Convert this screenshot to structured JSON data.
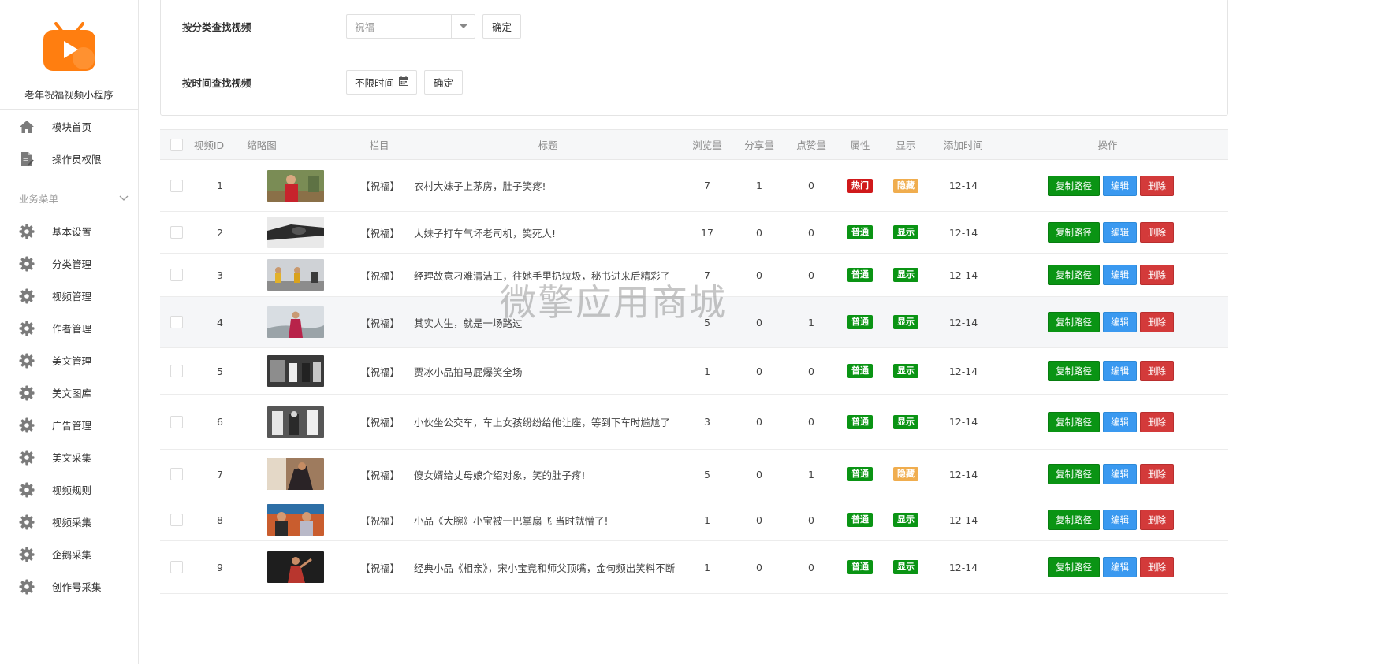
{
  "app": {
    "name": "老年祝福视频小程序",
    "brand_color": "#ff7e10"
  },
  "sidebar": {
    "top_items": [
      {
        "label": "模块首页",
        "icon": "home-icon"
      },
      {
        "label": "操作员权限",
        "icon": "file-edit-icon"
      }
    ],
    "group": {
      "label": "业务菜单",
      "icon": "chevron-down-icon"
    },
    "items": [
      {
        "label": "基本设置",
        "icon": "gear-icon"
      },
      {
        "label": "分类管理",
        "icon": "gear-icon"
      },
      {
        "label": "视频管理",
        "icon": "gear-icon"
      },
      {
        "label": "作者管理",
        "icon": "gear-icon"
      },
      {
        "label": "美文管理",
        "icon": "gear-icon"
      },
      {
        "label": "美文图库",
        "icon": "gear-icon"
      },
      {
        "label": "广告管理",
        "icon": "gear-icon"
      },
      {
        "label": "美文采集",
        "icon": "gear-icon"
      },
      {
        "label": "视频规则",
        "icon": "gear-icon"
      },
      {
        "label": "视频采集",
        "icon": "gear-icon"
      },
      {
        "label": "企鹅采集",
        "icon": "gear-icon"
      },
      {
        "label": "创作号采集",
        "icon": "gear-icon"
      }
    ]
  },
  "filters": {
    "category": {
      "label": "按分类查找视频",
      "selected": "祝福",
      "confirm": "确定"
    },
    "time": {
      "label": "按时间查找视频",
      "value": "不限时间",
      "icon": "calendar-icon",
      "confirm": "确定"
    }
  },
  "table": {
    "headers": {
      "id": "视频ID",
      "thumb": "缩略图",
      "column": "栏目",
      "title": "标题",
      "views": "浏览量",
      "shares": "分享量",
      "likes": "点赞量",
      "attr": "属性",
      "display": "显示",
      "added": "添加时间",
      "actions": "操作"
    },
    "actions": {
      "copy": "复制路径",
      "edit": "编辑",
      "delete": "删除"
    },
    "status_colors": {
      "hot": "#d0191b",
      "normal": "#0a9414",
      "show": "#0a9414",
      "hidden": "#f0ad4e"
    },
    "rows": [
      {
        "id": "1",
        "column": "【祝福】",
        "title": "农村大妹子上茅房，肚子笑疼!",
        "views": "7",
        "shares": "1",
        "likes": "0",
        "attr": "热门",
        "attr_type": "hot",
        "display": "隐藏",
        "display_type": "hidden",
        "added": "12-14",
        "thumb": "thumb-woman-red-dress"
      },
      {
        "id": "2",
        "column": "【祝福】",
        "title": "大妹子打车气坏老司机，笑死人!",
        "views": "17",
        "shares": "0",
        "likes": "0",
        "attr": "普通",
        "attr_type": "normal",
        "display": "显示",
        "display_type": "show",
        "added": "12-14",
        "thumb": "thumb-car-interior"
      },
      {
        "id": "3",
        "column": "【祝福】",
        "title": "经理故意刁难清洁工，往她手里扔垃圾，秘书进来后精彩了",
        "views": "7",
        "shares": "0",
        "likes": "0",
        "attr": "普通",
        "attr_type": "normal",
        "display": "显示",
        "display_type": "show",
        "added": "12-14",
        "thumb": "thumb-stage-performers"
      },
      {
        "id": "4",
        "column": "【祝福】",
        "title": "其实人生，就是一场路过",
        "views": "5",
        "shares": "0",
        "likes": "1",
        "attr": "普通",
        "attr_type": "normal",
        "display": "显示",
        "display_type": "show",
        "added": "12-14",
        "thumb": "thumb-singer-outdoor"
      },
      {
        "id": "5",
        "column": "【祝福】",
        "title": "贾冰小品拍马屁爆笑全场",
        "views": "1",
        "shares": "0",
        "likes": "0",
        "attr": "普通",
        "attr_type": "normal",
        "display": "显示",
        "display_type": "show",
        "added": "12-14",
        "thumb": "thumb-comedy-stage"
      },
      {
        "id": "6",
        "column": "【祝福】",
        "title": "小伙坐公交车，车上女孩纷纷给他让座，等到下车时尴尬了",
        "views": "3",
        "shares": "0",
        "likes": "0",
        "attr": "普通",
        "attr_type": "normal",
        "display": "显示",
        "display_type": "show",
        "added": "12-14",
        "thumb": "thumb-bus-passengers"
      },
      {
        "id": "7",
        "column": "【祝福】",
        "title": "傻女婿给丈母娘介绍对象，笑的肚子疼!",
        "views": "5",
        "shares": "0",
        "likes": "1",
        "attr": "普通",
        "attr_type": "normal",
        "display": "隐藏",
        "display_type": "hidden",
        "added": "12-14",
        "thumb": "thumb-family-scene"
      },
      {
        "id": "8",
        "column": "【祝福】",
        "title": "小品《大腕》小宝被一巴掌扇飞 当时就懵了!",
        "views": "1",
        "shares": "0",
        "likes": "0",
        "attr": "普通",
        "attr_type": "normal",
        "display": "显示",
        "display_type": "show",
        "added": "12-14",
        "thumb": "thumb-sketch-actors"
      },
      {
        "id": "9",
        "column": "【祝福】",
        "title": "经典小品《相亲》，宋小宝竟和师父顶嘴，金句频出笑料不断",
        "views": "1",
        "shares": "0",
        "likes": "0",
        "attr": "普通",
        "attr_type": "normal",
        "display": "显示",
        "display_type": "show",
        "added": "12-14",
        "thumb": "thumb-sketch-dark"
      }
    ]
  },
  "watermark": "微擎应用商城"
}
